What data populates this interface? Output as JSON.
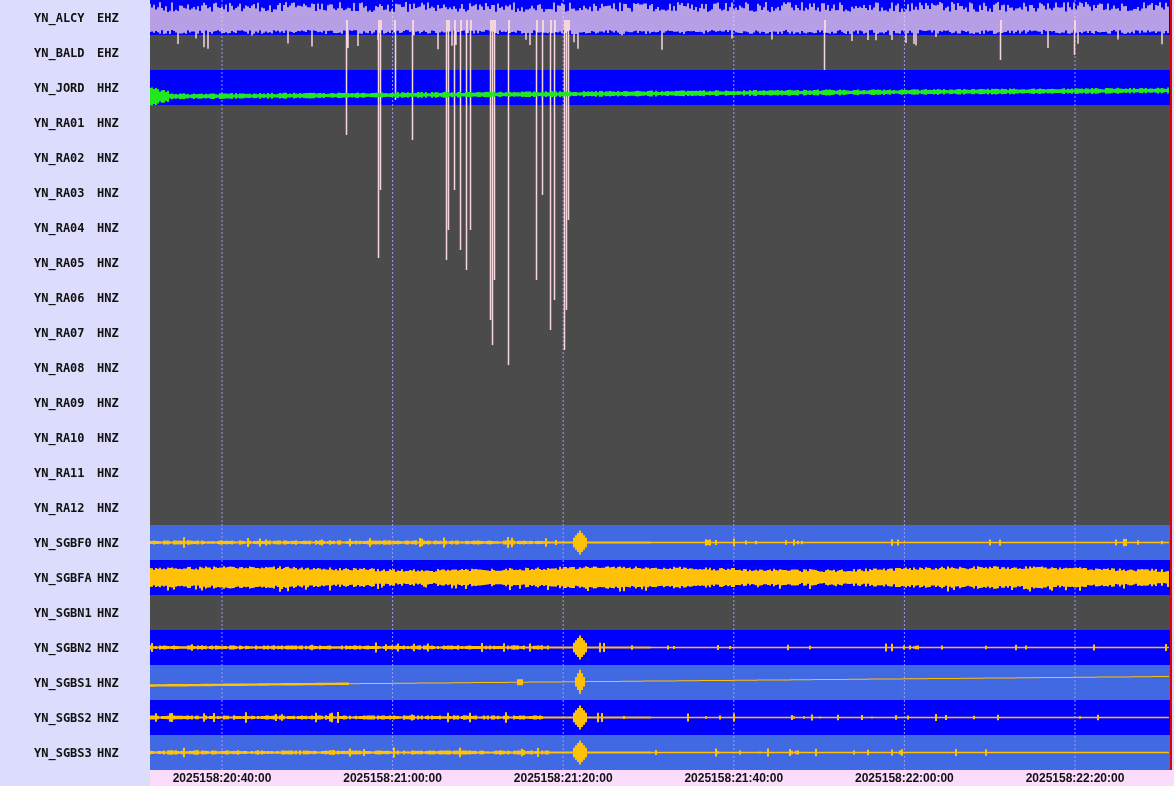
{
  "traces": [
    {
      "station": "YN_ALCY",
      "channel": "EHZ",
      "color": "#0000ff",
      "kind": "dense"
    },
    {
      "station": "YN_BALD",
      "channel": "EHZ",
      "color": "#4b4b4b",
      "kind": "none"
    },
    {
      "station": "YN_JORD",
      "channel": "HHZ",
      "color": "#0000ff",
      "kind": "decaying"
    },
    {
      "station": "YN_RA01",
      "channel": "HNZ",
      "color": "#4b4b4b",
      "kind": "none"
    },
    {
      "station": "YN_RA02",
      "channel": "HNZ",
      "color": "#4b4b4b",
      "kind": "none"
    },
    {
      "station": "YN_RA03",
      "channel": "HNZ",
      "color": "#4b4b4b",
      "kind": "none"
    },
    {
      "station": "YN_RA04",
      "channel": "HNZ",
      "color": "#4b4b4b",
      "kind": "none"
    },
    {
      "station": "YN_RA05",
      "channel": "HNZ",
      "color": "#4b4b4b",
      "kind": "none"
    },
    {
      "station": "YN_RA06",
      "channel": "HNZ",
      "color": "#4b4b4b",
      "kind": "none"
    },
    {
      "station": "YN_RA07",
      "channel": "HNZ",
      "color": "#4b4b4b",
      "kind": "none"
    },
    {
      "station": "YN_RA08",
      "channel": "HNZ",
      "color": "#4b4b4b",
      "kind": "none"
    },
    {
      "station": "YN_RA09",
      "channel": "HNZ",
      "color": "#4b4b4b",
      "kind": "none"
    },
    {
      "station": "YN_RA10",
      "channel": "HNZ",
      "color": "#4b4b4b",
      "kind": "none"
    },
    {
      "station": "YN_RA11",
      "channel": "HNZ",
      "color": "#4b4b4b",
      "kind": "none"
    },
    {
      "station": "YN_RA12",
      "channel": "HNZ",
      "color": "#4b4b4b",
      "kind": "none"
    },
    {
      "station": "YN_SGBF0",
      "channel": "HNZ",
      "color": "#4169e1",
      "kind": "event"
    },
    {
      "station": "YN_SGBFA",
      "channel": "HNZ",
      "color": "#0000ff",
      "kind": "broadband"
    },
    {
      "station": "YN_SGBN1",
      "channel": "HNZ",
      "color": "#4b4b4b",
      "kind": "none"
    },
    {
      "station": "YN_SGBN2",
      "channel": "HNZ",
      "color": "#0000ff",
      "kind": "event"
    },
    {
      "station": "YN_SGBS1",
      "channel": "HNZ",
      "color": "#4169e1",
      "kind": "quiet"
    },
    {
      "station": "YN_SGBS2",
      "channel": "HNZ",
      "color": "#0000ff",
      "kind": "event"
    },
    {
      "station": "YN_SGBS3",
      "channel": "HNZ",
      "color": "#4169e1",
      "kind": "event"
    }
  ],
  "time_axis": {
    "labels": [
      "2025158:20:40:00",
      "2025158:21:00:00",
      "2025158:21:20:00",
      "2025158:21:40:00",
      "2025158:22:00:00",
      "2025158:22:20:00"
    ]
  }
}
